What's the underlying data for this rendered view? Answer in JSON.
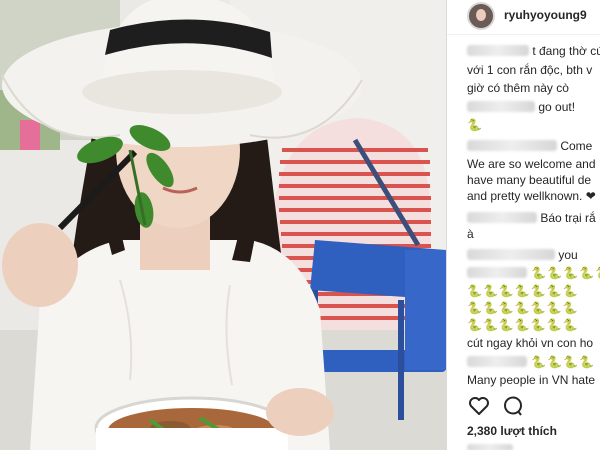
{
  "post": {
    "username": "ryuhyoyoung9",
    "caption_lines": [
      {
        "hidden": " ",
        "text": "t đang thờ cứ"
      },
      {
        "text": "với 1 con rắn độc, bth v"
      },
      {
        "text": "giờ có thêm      này cò"
      },
      {
        "hidden": " ",
        "text": "go out!"
      },
      {
        "emoji": "🐍"
      }
    ],
    "comments": [
      {
        "text": "Come",
        "lines": [
          "We are so welcome and",
          "have many beautiful de",
          "and pretty wellknown. ❤"
        ]
      },
      {
        "text": "Báo trại rắ",
        "lines": [
          "à"
        ]
      },
      {
        "text": "you",
        "emoji_rows": [
          "🐍🐍🐍🐍🐍",
          "🐍🐍🐍🐍🐍🐍🐍",
          "🐍🐍🐍🐍🐍🐍🐍",
          "🐍🐍🐍🐍🐍🐍🐍"
        ],
        "lines": [
          "cút ngay khỏi vn con ho"
        ]
      },
      {
        "emoji_rows": [
          "🐍🐍🐍🐍"
        ],
        "lines": [
          "Many people in VN hate"
        ]
      }
    ],
    "likes": "2,380 lượt thích",
    "date": ""
  },
  "photo": {
    "subject": "woman in wide-brim sun hat holding basil with chopsticks over a bowl of pho",
    "colors": {
      "hat": "#f4f2ee",
      "hat_band": "#1e1e1e",
      "hair": "#241a16",
      "skin": "#f0d6c4",
      "shirt": "#f7f5f2",
      "basil": "#3f8a2c",
      "stripe_red": "#d9534f",
      "chair_blue": "#2f5fbf",
      "background": "#e8e6e2"
    }
  },
  "icons": [
    "heart-icon",
    "comment-icon"
  ]
}
